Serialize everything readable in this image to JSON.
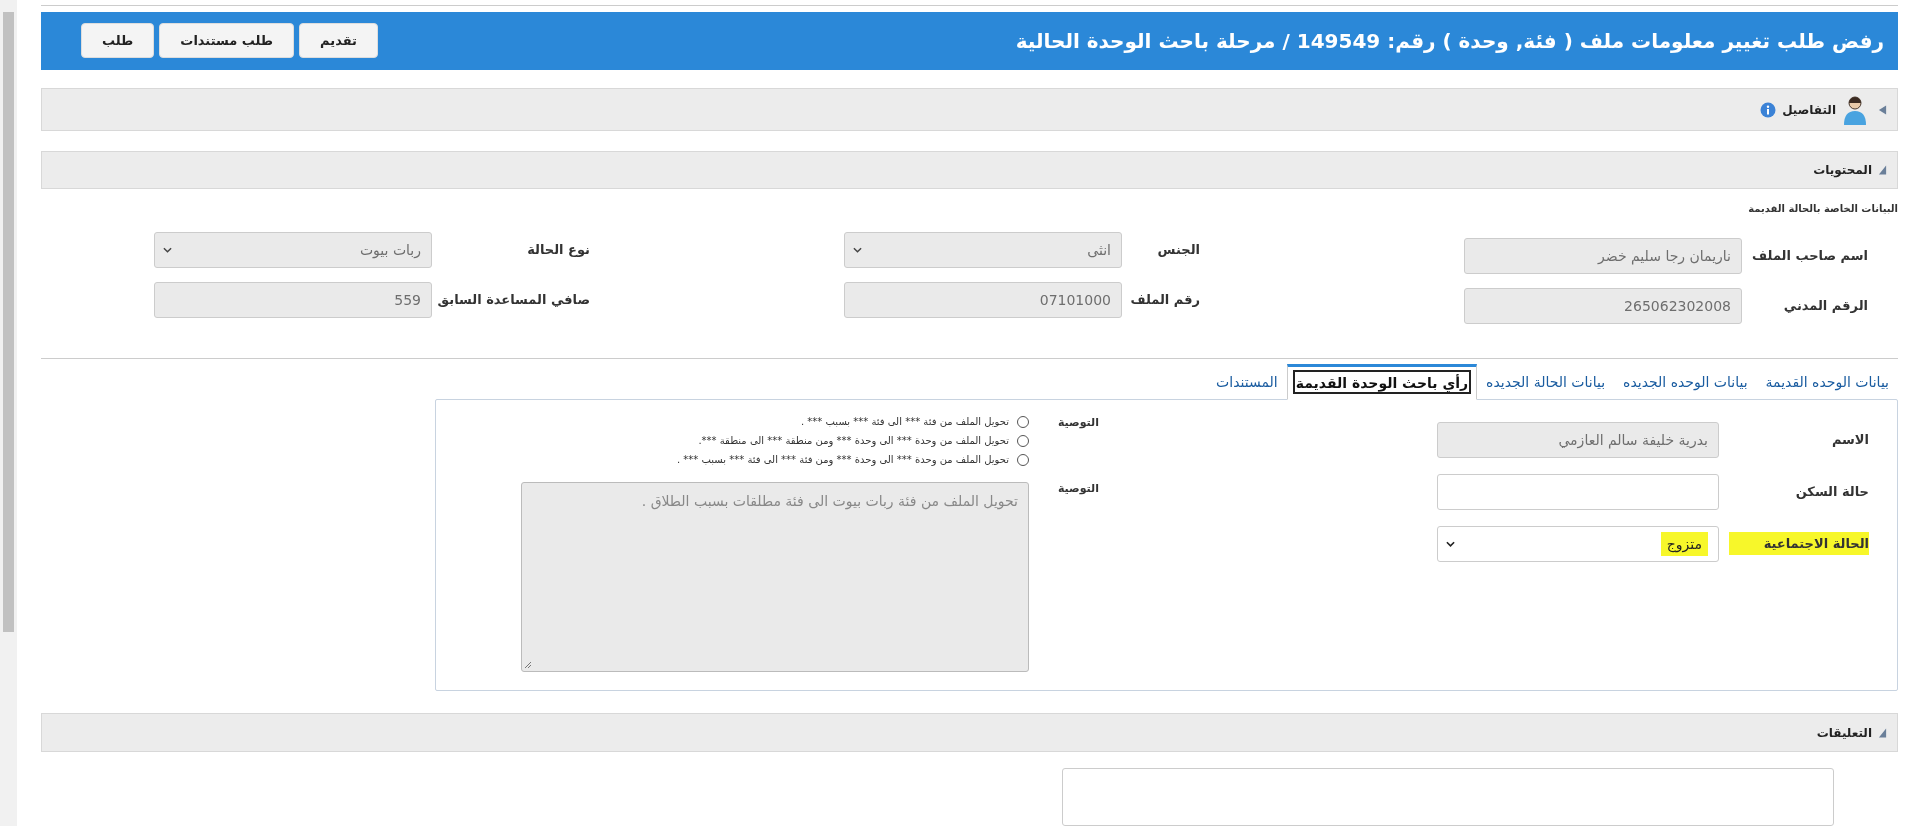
{
  "header": {
    "title": "رفض طلب تغيير معلومات ملف ( فئة, وحدة ) رقم: 149549 / مرحلة باحث الوحدة الحالية",
    "buttons": [
      "تقديم",
      "طلب مستندات",
      "طلب"
    ]
  },
  "details": {
    "label": "التفاصيل",
    "expanded": false
  },
  "contents": {
    "label": "المحتويات",
    "expanded": true
  },
  "old_case": {
    "title": "البيانات الخاصة بالحالة القديمة",
    "fields": [
      {
        "label": "اسم صاحب الملف",
        "kind": "input",
        "disabled": true,
        "value": "ناريمان رجا سليم خضر"
      },
      {
        "label": "الجنس",
        "kind": "select",
        "disabled": true,
        "value": "انثى"
      },
      {
        "label": "نوع الحالة",
        "kind": "select",
        "disabled": true,
        "value": "ربات بيوت"
      },
      {
        "label": "الرقم المدني",
        "kind": "input",
        "disabled": true,
        "value": "265062302008"
      },
      {
        "label": "رقم الملف",
        "kind": "input",
        "disabled": true,
        "value": "07101000"
      },
      {
        "label": "صافي المساعدة السابق",
        "kind": "input",
        "disabled": true,
        "value": "559"
      }
    ]
  },
  "tabs": [
    {
      "label": "بيانات الوحده القديمة",
      "selected": false
    },
    {
      "label": "بيانات الوحده الجديده",
      "selected": false
    },
    {
      "label": "بيانات الحالة الجديده",
      "selected": false
    },
    {
      "label": "رأي باحث الوحدة القديمة",
      "selected": true
    },
    {
      "label": "المستندات",
      "selected": false
    }
  ],
  "panel": {
    "fields": [
      {
        "label": "الاسم",
        "kind": "input",
        "disabled": true,
        "highlighted": false,
        "value": "بدرية خليفة سالم العازمي"
      },
      {
        "label": "حالة السكن",
        "kind": "input",
        "disabled": false,
        "highlighted": false
      },
      {
        "label": "الحالة الاجتماعية",
        "kind": "select",
        "disabled": false,
        "highlighted": true,
        "value": "متزوج"
      }
    ],
    "recommendation_options": {
      "label": "التوصية",
      "options": [
        {
          "text": "تحويل الملف من فئة *** الى فئة *** بسبب *** .",
          "selected": false
        },
        {
          "text": "تحويل الملف من وحدة *** الى وحدة *** ومن منطقة *** الى منطقة ***.",
          "selected": false
        },
        {
          "text": "تحويل الملف من وحدة *** الى وحدة *** ومن فئة *** الى فئة *** بسبب *** .",
          "selected": false
        }
      ]
    },
    "recommendation_text": {
      "label": "التوصية",
      "value": "تحويل الملف  من فئة ربات بيوت الى فئة مطلقات بسبب الطلاق ."
    }
  },
  "comments": {
    "label": "التعليقات",
    "expanded": true
  }
}
